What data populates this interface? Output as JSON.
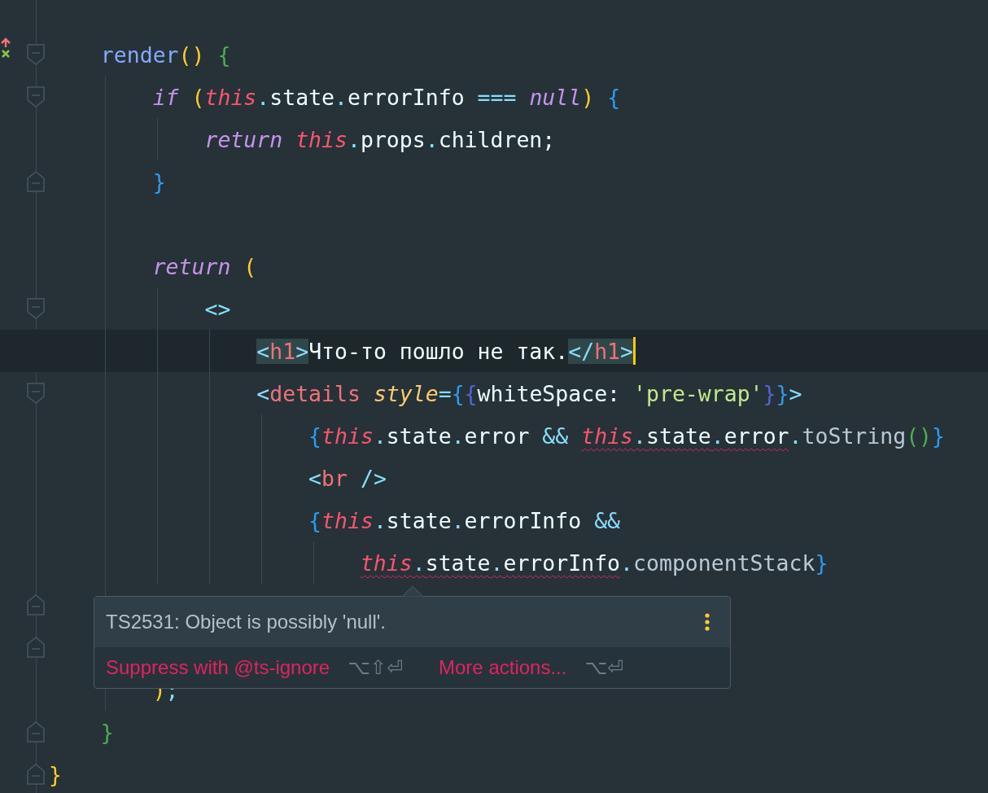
{
  "editor": {
    "lines": [
      {
        "fold_start": true,
        "vcs_change": true,
        "tokens": [
          {
            "text": "    render",
            "kind": "func"
          },
          {
            "text": "() ",
            "kind": "br1"
          },
          {
            "text": "{",
            "kind": "br2"
          }
        ]
      },
      {
        "fold_start": true,
        "tokens": [
          {
            "text": "        if ",
            "kind": "kw"
          },
          {
            "text": "(",
            "kind": "br1"
          },
          {
            "text": "this",
            "kind": "this"
          },
          {
            "text": ".",
            "kind": "dot"
          },
          {
            "text": "state",
            "kind": "ident"
          },
          {
            "text": ".",
            "kind": "dot"
          },
          {
            "text": "errorInfo ",
            "kind": "ident"
          },
          {
            "text": "=== ",
            "kind": "op"
          },
          {
            "text": "null",
            "kind": "kw"
          },
          {
            "text": ") ",
            "kind": "br1"
          },
          {
            "text": "{",
            "kind": "br3"
          }
        ]
      },
      {
        "tokens": [
          {
            "text": "            return ",
            "kind": "kw"
          },
          {
            "text": "this",
            "kind": "this"
          },
          {
            "text": ".",
            "kind": "dot"
          },
          {
            "text": "props",
            "kind": "ident"
          },
          {
            "text": ".",
            "kind": "dot"
          },
          {
            "text": "children;",
            "kind": "ident"
          }
        ]
      },
      {
        "fold_end": true,
        "tokens": [
          {
            "text": "        }",
            "kind": "br3"
          }
        ]
      },
      {
        "blank_line_before": true,
        "tokens": [
          {
            "text": "        return ",
            "kind": "kw"
          },
          {
            "text": "(",
            "kind": "br1"
          }
        ]
      },
      {
        "fold_start": true,
        "tokens": [
          {
            "text": "            <>",
            "kind": "tagp"
          }
        ]
      },
      {
        "current": true,
        "tokens": [
          {
            "text": "                <",
            "kind": "tagp",
            "match": true
          },
          {
            "text": "h1",
            "kind": "tag",
            "match": true
          },
          {
            "text": ">",
            "kind": "tagp",
            "match": true
          },
          {
            "text": "Что-то пошло не так.",
            "kind": "ident"
          },
          {
            "text": "</",
            "kind": "tagp",
            "match": true
          },
          {
            "text": "h1",
            "kind": "tag",
            "match": true
          },
          {
            "text": ">",
            "kind": "tagp",
            "match": true
          }
        ]
      },
      {
        "fold_start": true,
        "tokens": [
          {
            "text": "                <",
            "kind": "tagp"
          },
          {
            "text": "details ",
            "kind": "tag"
          },
          {
            "text": "style",
            "kind": "attr"
          },
          {
            "text": "=",
            "kind": "op"
          },
          {
            "text": "{",
            "kind": "br3"
          },
          {
            "text": "{",
            "kind": "br4"
          },
          {
            "text": "whiteSpace: ",
            "kind": "ident"
          },
          {
            "text": "'pre-wrap'",
            "kind": "str"
          },
          {
            "text": "}",
            "kind": "br4"
          },
          {
            "text": "}",
            "kind": "br3"
          },
          {
            "text": ">",
            "kind": "tagp"
          }
        ]
      },
      {
        "tokens": [
          {
            "text": "                    {",
            "kind": "br3"
          },
          {
            "text": "this",
            "kind": "this"
          },
          {
            "text": ".",
            "kind": "dot"
          },
          {
            "text": "state",
            "kind": "ident"
          },
          {
            "text": ".",
            "kind": "dot"
          },
          {
            "text": "error ",
            "kind": "ident"
          },
          {
            "text": "&& ",
            "kind": "op"
          },
          {
            "text": "this",
            "kind": "this",
            "error": true
          },
          {
            "text": ".",
            "kind": "dot",
            "error": true
          },
          {
            "text": "state",
            "kind": "ident",
            "error": true
          },
          {
            "text": ".",
            "kind": "dot",
            "error": true
          },
          {
            "text": "error",
            "kind": "ident",
            "error": true
          },
          {
            "text": ".",
            "kind": "dot"
          },
          {
            "text": "toString",
            "kind": "method"
          },
          {
            "text": "()",
            "kind": "br2"
          },
          {
            "text": "}",
            "kind": "br3"
          }
        ]
      },
      {
        "tokens": [
          {
            "text": "                    <",
            "kind": "tagp"
          },
          {
            "text": "br ",
            "kind": "tag"
          },
          {
            "text": "/>",
            "kind": "tagp"
          }
        ]
      },
      {
        "tokens": [
          {
            "text": "                    {",
            "kind": "br3"
          },
          {
            "text": "this",
            "kind": "this"
          },
          {
            "text": ".",
            "kind": "dot"
          },
          {
            "text": "state",
            "kind": "ident"
          },
          {
            "text": ".",
            "kind": "dot"
          },
          {
            "text": "errorInfo ",
            "kind": "ident"
          },
          {
            "text": "&&",
            "kind": "op"
          }
        ]
      },
      {
        "tokens": [
          {
            "text": "                        this",
            "kind": "this",
            "error": true
          },
          {
            "text": ".",
            "kind": "dot",
            "error": true
          },
          {
            "text": "state",
            "kind": "ident",
            "error": true
          },
          {
            "text": ".",
            "kind": "dot",
            "error": true
          },
          {
            "text": "errorInfo",
            "kind": "ident",
            "error": true
          },
          {
            "text": ".",
            "kind": "dot"
          },
          {
            "text": "componentStack",
            "kind": "method"
          },
          {
            "text": "}",
            "kind": "br3"
          }
        ]
      },
      {
        "fold_end": true
      },
      {
        "fold_end": true
      },
      {
        "tokens": [
          {
            "text": "        )",
            "kind": "br1"
          },
          {
            "text": ";",
            "kind": "dot"
          }
        ]
      },
      {
        "fold_end": true,
        "tokens": [
          {
            "text": "    }",
            "kind": "br2"
          }
        ]
      },
      {
        "fold_end": true,
        "tokens": [
          {
            "text": "}",
            "kind": "br1"
          }
        ]
      }
    ]
  },
  "tooltip": {
    "message": "TS2531: Object is possibly 'null'.",
    "actions": [
      {
        "label": "Suppress with @ts-ignore",
        "shortcut": "⌥⇧⏎"
      },
      {
        "label": "More actions...",
        "shortcut": "⌥⏎"
      }
    ]
  }
}
